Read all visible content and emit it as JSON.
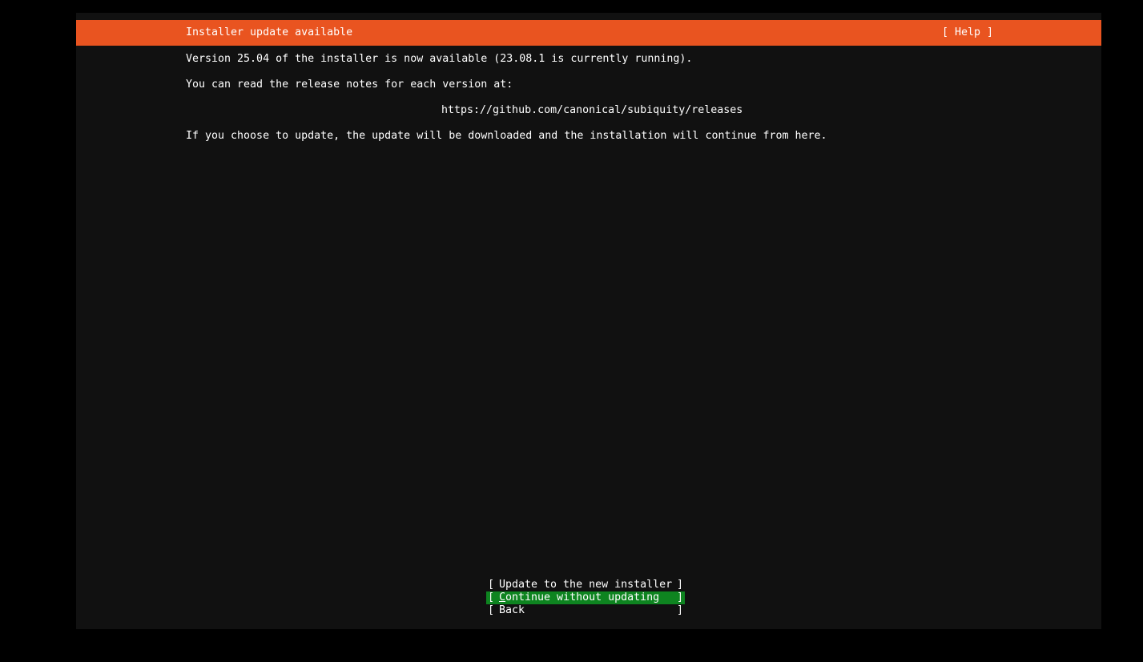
{
  "header": {
    "title": "Installer update available",
    "help_label": "[ Help ]"
  },
  "body": {
    "version_line": "Version 25.04 of the installer is now available (23.08.1 is currently running).",
    "notes_line": "You can read the release notes for each version at:",
    "url": "https://github.com/canonical/subiquity/releases",
    "update_line": "If you choose to update, the update will be downloaded and the installation will continue from here."
  },
  "buttons": {
    "left_bracket": "[",
    "right_bracket": "]",
    "update_label": "Update to the new installer",
    "continue_first_char": "C",
    "continue_rest": "ontinue without updating",
    "back_label": "Back"
  },
  "colors": {
    "header_bg": "#e95420",
    "focus_bg": "#0e8420",
    "screen_bg": "#111111"
  }
}
